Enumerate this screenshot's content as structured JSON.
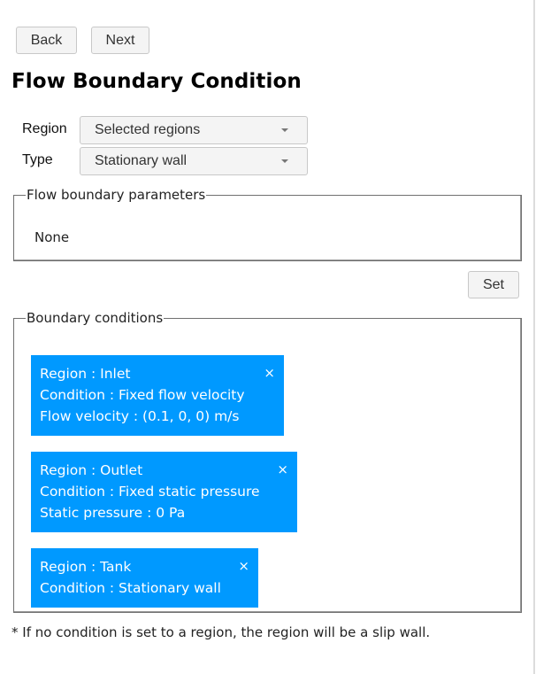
{
  "toolbar": {
    "back_label": "Back",
    "next_label": "Next"
  },
  "page_title": "Flow Boundary Condition",
  "form": {
    "region_label": "Region",
    "region_value": "Selected regions",
    "type_label": "Type",
    "type_value": "Stationary wall"
  },
  "params": {
    "legend": "Flow boundary parameters",
    "value": "None"
  },
  "set_label": "Set",
  "boundary_conditions": {
    "legend": "Boundary conditions",
    "close_glyph": "×",
    "cards": [
      {
        "lines": [
          "Region : Inlet",
          "Condition : Fixed flow velocity",
          "Flow velocity : (0.1, 0, 0) m/s"
        ]
      },
      {
        "lines": [
          "Region : Outlet",
          "Condition : Fixed static pressure",
          "Static pressure : 0 Pa"
        ]
      },
      {
        "lines": [
          "Region : Tank",
          "Condition : Stationary wall"
        ]
      }
    ]
  },
  "footnote": "* If no condition is set to a region, the region will be a slip wall.",
  "colors": {
    "card_bg": "#0099ff",
    "card_text": "#ffffff"
  }
}
